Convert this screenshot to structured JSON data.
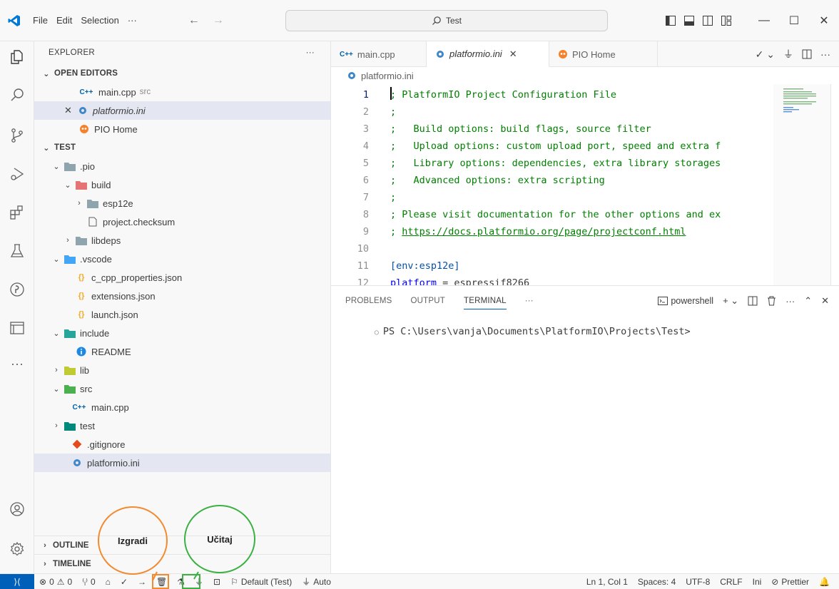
{
  "titlebar": {
    "menu": [
      "File",
      "Edit",
      "Selection",
      "···"
    ],
    "search_text": "Test"
  },
  "sidebar": {
    "header": "EXPLORER",
    "open_editors_label": "OPEN EDITORS",
    "open_editors": [
      {
        "name": "main.cpp",
        "desc": "src"
      },
      {
        "name": "platformio.ini"
      },
      {
        "name": "PIO Home"
      }
    ],
    "project_label": "TEST",
    "tree": [
      ".pio",
      "build",
      "esp12e",
      "project.checksum",
      "libdeps",
      ".vscode",
      "c_cpp_properties.json",
      "extensions.json",
      "launch.json",
      "include",
      "README",
      "lib",
      "src",
      "main.cpp",
      "test",
      ".gitignore",
      "platformio.ini"
    ],
    "outline_label": "OUTLINE",
    "timeline_label": "TIMELINE"
  },
  "tabs": [
    "main.cpp",
    "platformio.ini",
    "PIO Home"
  ],
  "breadcrumb": "platformio.ini",
  "code": {
    "line_numbers": [
      "1",
      "2",
      "3",
      "4",
      "5",
      "6",
      "7",
      "8",
      "9",
      "10",
      "11",
      "12"
    ],
    "lines": [
      "; PlatformIO Project Configuration File",
      ";",
      ";   Build options: build flags, source filter",
      ";   Upload options: custom upload port, speed and extra f",
      ";   Library options: dependencies, extra library storages",
      ";   Advanced options: extra scripting",
      ";",
      "; Please visit documentation for the other options and ex",
      "https://docs.platformio.org/page/projectconf.html",
      "",
      "[env:esp12e]",
      "platform",
      " = espressif8266"
    ],
    "line9_prefix": "; "
  },
  "panel": {
    "tabs": [
      "PROBLEMS",
      "OUTPUT",
      "TERMINAL",
      "···"
    ],
    "shell": "powershell",
    "terminal_line": "PS C:\\Users\\vanja\\Documents\\PlatformIO\\Projects\\Test>"
  },
  "statusbar": {
    "errors": "0",
    "warnings": "0",
    "ports": "0",
    "env": "Default (Test)",
    "auto": "Auto",
    "position": "Ln 1, Col 1",
    "spaces": "Spaces: 4",
    "encoding": "UTF-8",
    "eol": "CRLF",
    "lang": "Ini",
    "prettier": "Prettier"
  },
  "annotations": {
    "build_label": "Izgradi",
    "upload_label": "Učitaj",
    "build_color": "#f28b30",
    "upload_color": "#3cb043"
  },
  "colors": {
    "accent": "#005fb8",
    "comment": "#008000",
    "key": "#0000ff",
    "folder": "#90a4ae",
    "pio_orange": "#f5822a"
  }
}
